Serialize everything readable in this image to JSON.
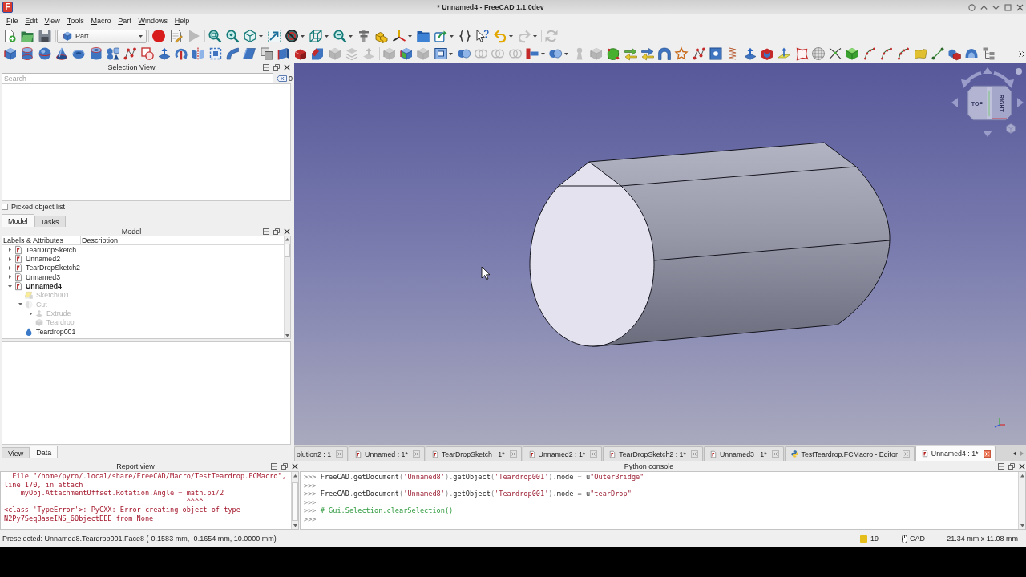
{
  "window": {
    "logo": "F",
    "title": "* Unnamed4 - FreeCAD 1.1.0dev"
  },
  "menu": [
    "File",
    "Edit",
    "View",
    "Tools",
    "Macro",
    "Part",
    "Windows",
    "Help"
  ],
  "toolbar_1": {
    "groups": [
      [
        {
          "kind": "new",
          "disabled": false,
          "dropdown": false
        },
        {
          "kind": "open",
          "disabled": false,
          "dropdown": false
        },
        {
          "kind": "save",
          "disabled": false,
          "dropdown": false
        }
      ],
      [
        {
          "kind": "workbench",
          "value": "Part",
          "disabled": false,
          "dropdown": true
        }
      ],
      [
        {
          "kind": "record",
          "disabled": false,
          "dropdown": false
        },
        {
          "kind": "macro-edit",
          "disabled": false,
          "dropdown": false
        },
        {
          "kind": "play",
          "disabled": true,
          "dropdown": false
        }
      ],
      [
        {
          "kind": "fit-all",
          "disabled": false,
          "dropdown": false
        },
        {
          "kind": "fit-selection",
          "disabled": false,
          "dropdown": false
        },
        {
          "kind": "iso-cube",
          "disabled": false,
          "dropdown": true
        },
        {
          "kind": "box-zoom",
          "disabled": false,
          "dropdown": false
        },
        {
          "kind": "draw-style",
          "disabled": false,
          "dropdown": true
        },
        {
          "kind": "bound-box",
          "disabled": false,
          "dropdown": true
        },
        {
          "kind": "zoom",
          "disabled": false,
          "dropdown": true
        },
        {
          "kind": "measure",
          "disabled": false,
          "dropdown": false
        },
        {
          "kind": "part",
          "disabled": false,
          "dropdown": false
        },
        {
          "kind": "axes",
          "disabled": false,
          "dropdown": true
        },
        {
          "kind": "folder",
          "disabled": false,
          "dropdown": false
        },
        {
          "kind": "link",
          "disabled": false,
          "dropdown": true
        },
        {
          "kind": "braces",
          "disabled": false,
          "dropdown": false
        },
        {
          "kind": "whats-this",
          "disabled": false,
          "dropdown": false
        },
        {
          "kind": "undo",
          "disabled": false,
          "dropdown": true
        },
        {
          "kind": "redo",
          "disabled": true,
          "dropdown": true
        }
      ],
      [
        {
          "kind": "refresh",
          "disabled": true,
          "dropdown": false
        }
      ]
    ]
  },
  "toolbar_2": {
    "groups": [
      [
        {
          "kind": "box",
          "disabled": false,
          "dropdown": false
        },
        {
          "kind": "cylinder",
          "disabled": false,
          "dropdown": false
        },
        {
          "kind": "sphere",
          "disabled": false,
          "dropdown": false
        },
        {
          "kind": "cone",
          "disabled": false,
          "dropdown": false
        },
        {
          "kind": "torus",
          "disabled": false,
          "dropdown": false
        },
        {
          "kind": "tube",
          "disabled": false,
          "dropdown": false
        },
        {
          "kind": "shapes",
          "disabled": false,
          "dropdown": false
        },
        {
          "kind": "nodes",
          "disabled": false,
          "dropdown": false
        },
        {
          "kind": "square-circle",
          "disabled": false,
          "dropdown": false
        },
        {
          "kind": "extrude",
          "disabled": false,
          "dropdown": false
        },
        {
          "kind": "revolve",
          "disabled": false,
          "dropdown": false
        },
        {
          "kind": "mirror",
          "disabled": false,
          "dropdown": false
        },
        {
          "kind": "offset",
          "disabled": false,
          "dropdown": false
        },
        {
          "kind": "curved-sheet",
          "disabled": false,
          "dropdown": false
        },
        {
          "kind": "sheet",
          "disabled": false,
          "dropdown": false
        },
        {
          "kind": "squares",
          "disabled": false,
          "dropdown": false
        },
        {
          "kind": "panel",
          "disabled": false,
          "dropdown": false
        },
        {
          "kind": "wedge",
          "disabled": false,
          "dropdown": false
        },
        {
          "kind": "chamfer",
          "disabled": false,
          "dropdown": false
        },
        {
          "kind": "box",
          "disabled": true,
          "dropdown": false
        },
        {
          "kind": "stack",
          "disabled": true,
          "dropdown": false
        },
        {
          "kind": "layers-up",
          "disabled": true,
          "dropdown": false
        }
      ],
      [
        {
          "kind": "box",
          "disabled": true,
          "dropdown": false
        },
        {
          "kind": "box-face",
          "disabled": false,
          "dropdown": false
        },
        {
          "kind": "box",
          "disabled": true,
          "dropdown": false
        },
        {
          "kind": "frame",
          "disabled": false,
          "dropdown": true
        },
        {
          "kind": "spheres",
          "disabled": false,
          "dropdown": false
        },
        {
          "kind": "rings",
          "disabled": true,
          "dropdown": false
        },
        {
          "kind": "rings",
          "disabled": true,
          "dropdown": false
        },
        {
          "kind": "rings",
          "disabled": true,
          "dropdown": false
        },
        {
          "kind": "t-shape",
          "disabled": false,
          "dropdown": true
        },
        {
          "kind": "spheres",
          "disabled": false,
          "dropdown": true
        },
        {
          "kind": "pawn",
          "disabled": true,
          "dropdown": false
        },
        {
          "kind": "box",
          "disabled": true,
          "dropdown": false
        },
        {
          "kind": "blob",
          "disabled": false,
          "dropdown": false
        },
        {
          "kind": "arrows",
          "disabled": false,
          "dropdown": false
        },
        {
          "kind": "arrows-blue",
          "disabled": false,
          "dropdown": false
        },
        {
          "kind": "loft",
          "disabled": false,
          "dropdown": false
        },
        {
          "kind": "star",
          "disabled": false,
          "dropdown": false
        },
        {
          "kind": "nodes",
          "disabled": false,
          "dropdown": false
        },
        {
          "kind": "square-hole",
          "disabled": false,
          "dropdown": false
        },
        {
          "kind": "spring",
          "disabled": false,
          "dropdown": false
        },
        {
          "kind": "extrude",
          "disabled": false,
          "dropdown": false
        },
        {
          "kind": "thickness",
          "disabled": false,
          "dropdown": false
        },
        {
          "kind": "plane",
          "disabled": false,
          "dropdown": false
        },
        {
          "kind": "polygon",
          "disabled": false,
          "dropdown": false
        },
        {
          "kind": "mesh",
          "disabled": false,
          "dropdown": false
        },
        {
          "kind": "cross",
          "disabled": false,
          "dropdown": false
        },
        {
          "kind": "green-cube",
          "disabled": false,
          "dropdown": false
        },
        {
          "kind": "dotted-curve",
          "disabled": false,
          "dropdown": false
        },
        {
          "kind": "dotted-curve",
          "disabled": false,
          "dropdown": false
        },
        {
          "kind": "dotted-curve",
          "disabled": false,
          "dropdown": false
        },
        {
          "kind": "surface",
          "disabled": false,
          "dropdown": false
        },
        {
          "kind": "line",
          "disabled": false,
          "dropdown": false
        },
        {
          "kind": "cubes",
          "disabled": false,
          "dropdown": false
        },
        {
          "kind": "dome",
          "disabled": false,
          "dropdown": false
        },
        {
          "kind": "tree",
          "disabled": false,
          "dropdown": false
        }
      ]
    ],
    "overflow": true
  },
  "selection_view": {
    "title": "Selection View",
    "search": {
      "placeholder": "Search"
    },
    "count": "0",
    "picked_list": {
      "label": "Picked object list",
      "checked": false
    }
  },
  "left_tabs": [
    {
      "label": "Model",
      "selected": true
    },
    {
      "label": "Tasks",
      "selected": false
    }
  ],
  "model": {
    "title": "Model",
    "columns": [
      "Labels & Attributes",
      "Description"
    ],
    "tree": [
      {
        "label": "TearDropSketch",
        "kind": "document",
        "expanded": false,
        "active": false
      },
      {
        "label": "Unnamed2",
        "kind": "document",
        "expanded": false,
        "active": false
      },
      {
        "label": "TearDropSketch2",
        "kind": "document",
        "expanded": false,
        "active": false
      },
      {
        "label": "Unnamed3",
        "kind": "document",
        "expanded": false,
        "active": false
      },
      {
        "label": "Unnamed4",
        "kind": "document",
        "expanded": true,
        "active": true,
        "children": [
          {
            "label": "Sketch001",
            "kind": "sketch",
            "visible": false
          },
          {
            "label": "Cut",
            "kind": "cut",
            "visible": false,
            "expanded": true,
            "children": [
              {
                "label": "Extrude",
                "kind": "extrude",
                "visible": false,
                "expanded": false
              },
              {
                "label": "Teardrop",
                "kind": "solid",
                "visible": false
              }
            ]
          },
          {
            "label": "Teardrop001",
            "kind": "teardrop",
            "visible": true
          }
        ]
      }
    ]
  },
  "property_tabs": [
    {
      "label": "View",
      "selected": false
    },
    {
      "label": "Data",
      "selected": true
    }
  ],
  "view3d": {
    "nav_cube": {
      "faces": [
        "TOP",
        "RIGHT"
      ]
    }
  },
  "document_tabs": [
    {
      "label": "olution2 : 1",
      "kind": "clipped",
      "selected": false
    },
    {
      "label": "Unnamed : 1*",
      "kind": "document",
      "selected": false
    },
    {
      "label": "TearDropSketch : 1*",
      "kind": "document",
      "selected": false
    },
    {
      "label": "Unnamed2 : 1*",
      "kind": "document",
      "selected": false
    },
    {
      "label": "TearDropSketch2 : 1*",
      "kind": "document",
      "selected": false
    },
    {
      "label": "Unnamed3 : 1*",
      "kind": "document",
      "selected": false
    },
    {
      "label": "TestTeardrop.FCMacro - Editor",
      "kind": "macro",
      "selected": false
    },
    {
      "label": "Unnamed4 : 1*",
      "kind": "document",
      "selected": true
    }
  ],
  "report_view": {
    "title": "Report view",
    "lines": [
      "  File \"/home/pyro/.local/share/FreeCAD/Macro/TestTeardrop.FCMacro\",",
      "line 170, in attach",
      "    myObj.AttachmentOffset.Rotation.Angle = math.pi/2",
      "                                            ^^^^",
      "<class 'TypeError'>: PyCXX: Error creating object of type",
      "N2Py7SeqBaseINS_6ObjectEEE from None"
    ]
  },
  "python_console": {
    "title": "Python console",
    "lines": [
      {
        "segments": [
          {
            "kind": "prompt",
            "text": ">>> "
          },
          {
            "kind": "name",
            "text": "FreeCAD"
          },
          {
            "kind": "op",
            "text": "."
          },
          {
            "kind": "name",
            "text": "getDocument"
          },
          {
            "kind": "op",
            "text": "("
          },
          {
            "kind": "string",
            "text": "'Unnamed8'"
          },
          {
            "kind": "op",
            "text": ")."
          },
          {
            "kind": "name",
            "text": "getObject"
          },
          {
            "kind": "op",
            "text": "("
          },
          {
            "kind": "string",
            "text": "'Teardrop001'"
          },
          {
            "kind": "op",
            "text": ")."
          },
          {
            "kind": "name",
            "text": "mode "
          },
          {
            "kind": "op",
            "text": "="
          },
          {
            "kind": "name",
            "text": " u"
          },
          {
            "kind": "string",
            "text": "\"OuterBridge\""
          }
        ]
      },
      {
        "segments": [
          {
            "kind": "prompt",
            "text": ">>>"
          }
        ]
      },
      {
        "segments": [
          {
            "kind": "prompt",
            "text": ">>> "
          },
          {
            "kind": "name",
            "text": "FreeCAD"
          },
          {
            "kind": "op",
            "text": "."
          },
          {
            "kind": "name",
            "text": "getDocument"
          },
          {
            "kind": "op",
            "text": "("
          },
          {
            "kind": "string",
            "text": "'Unnamed8'"
          },
          {
            "kind": "op",
            "text": ")."
          },
          {
            "kind": "name",
            "text": "getObject"
          },
          {
            "kind": "op",
            "text": "("
          },
          {
            "kind": "string",
            "text": "'Teardrop001'"
          },
          {
            "kind": "op",
            "text": ")."
          },
          {
            "kind": "name",
            "text": "mode "
          },
          {
            "kind": "op",
            "text": "="
          },
          {
            "kind": "name",
            "text": " u"
          },
          {
            "kind": "string",
            "text": "\"tearDrop\""
          }
        ]
      },
      {
        "segments": [
          {
            "kind": "prompt",
            "text": ">>>"
          }
        ]
      },
      {
        "segments": [
          {
            "kind": "prompt",
            "text": ">>> "
          },
          {
            "kind": "comment",
            "text": "# Gui.Selection.clearSelection()"
          }
        ]
      },
      {
        "segments": [
          {
            "kind": "prompt",
            "text": ">>>"
          }
        ]
      }
    ]
  },
  "status_bar": {
    "message": "Preselected: Unnamed8.Teardrop001.Face8 (-0.1583 mm, -0.1654 mm, 10.0000 mm)",
    "notifications": "19",
    "navigation_style": "CAD",
    "dimensions": "21.34 mm x 11.08 mm"
  }
}
